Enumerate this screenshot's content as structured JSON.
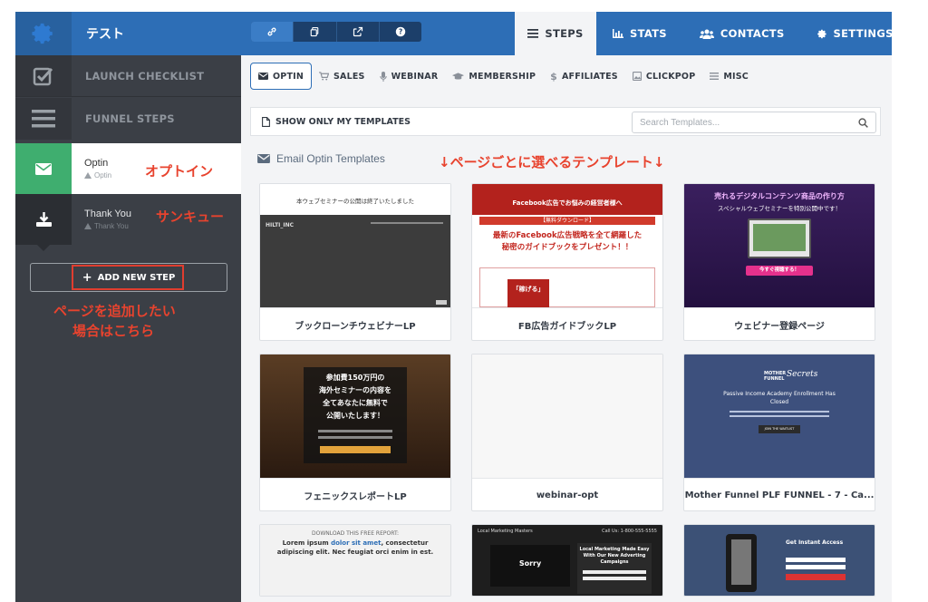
{
  "topbar": {
    "funnel_title": "テスト",
    "tabs": [
      {
        "label": "STEPS",
        "active": true
      },
      {
        "label": "STATS"
      },
      {
        "label": "CONTACTS"
      },
      {
        "label": "SETTINGS"
      }
    ]
  },
  "sidebar": {
    "launch_checklist": "LAUNCH CHECKLIST",
    "funnel_steps": "FUNNEL STEPS",
    "steps": [
      {
        "name": "Optin",
        "sub": "Optin",
        "icon": "envelope-icon"
      },
      {
        "name": "Thank You",
        "sub": "Thank You",
        "icon": "download-icon"
      }
    ],
    "add_step": "ADD NEW STEP"
  },
  "annotations": {
    "optin": "オプトイン",
    "thanks": "サンキュー",
    "add_note_line1": "ページを追加したい",
    "add_note_line2": "場合はこちら",
    "templates_note": "↓ページごとに選べるテンプレート↓"
  },
  "main": {
    "subtabs": [
      "OPTIN",
      "SALES",
      "WEBINAR",
      "MEMBERSHIP",
      "AFFILIATES",
      "CLICKPOP",
      "MISC"
    ],
    "filter_label": "SHOW ONLY MY TEMPLATES",
    "search_placeholder": "Search Templates...",
    "section_title": "Email Optin Templates",
    "templates": [
      {
        "label": "ブックローンチウェビナーLP"
      },
      {
        "label": "FB広告ガイドブックLP"
      },
      {
        "label": "ウェビナー登録ページ"
      },
      {
        "label": "フェニックスレポートLP"
      },
      {
        "label": "webinar-opt"
      },
      {
        "label": "Mother Funnel PLF FUNNEL - 7 - Ca..."
      }
    ],
    "thumb_text": {
      "t1_title": "本ウェブセミナーの公開は終了いたしました",
      "t1_logo": "HILTI_INC",
      "t2_banner": "Facebook広告でお悩みの経営者様へ",
      "t2_tag": "【無料ダウンロード】",
      "t2_line1": "最新のFacebook広告戦略を全て網羅した",
      "t2_line2": "秘密のガイドブックをプレゼント！！",
      "t2_book": "「稼げる」",
      "t3_line1": "売れるデジタルコンテンツ商品の作り方",
      "t3_line2": "スペシャルウェブセミナーを特別公開中です！",
      "t3_btn": "今すぐ視聴する！",
      "t4_line1": "参加費150万円の",
      "t4_line2": "海外セミナーの内容を",
      "t4_line3": "全てあなたに無料で",
      "t4_line4": "公開いたします！",
      "t6_logo1": "MOTHER",
      "t6_logo2": "FUNNEL",
      "t6_logo3": "Secrets",
      "t6_line1": "Passive Income Academy Enrollment Has",
      "t6_line2": "Closed",
      "t6_btn": "JOIN THE WAITLIST",
      "t7_top": "DOWNLOAD THIS FREE REPORT:",
      "t7_l1a": "Lorem ipsum ",
      "t7_l1b": "dolor sit amet",
      "t7_l1c": ", consectetur",
      "t7_l2": "adipiscing elit. Nec feugiat orci enim in est.",
      "t8_brand": "Local Marketing Masters",
      "t8_call": "Call Us: 1-800-555-5555",
      "t8_sorry": "Sorry",
      "t8_h1": "Local Marketing Made Easy",
      "t8_h2": "With Our New Adverting",
      "t8_h3": "Campaigns",
      "t9_title": "Get Instant Access"
    }
  },
  "colors": {
    "brand_blue": "#2d6eb6",
    "sidebar_dark": "#3b3f46",
    "optin_green": "#3fae6f",
    "annotation_red": "#e8432e"
  }
}
